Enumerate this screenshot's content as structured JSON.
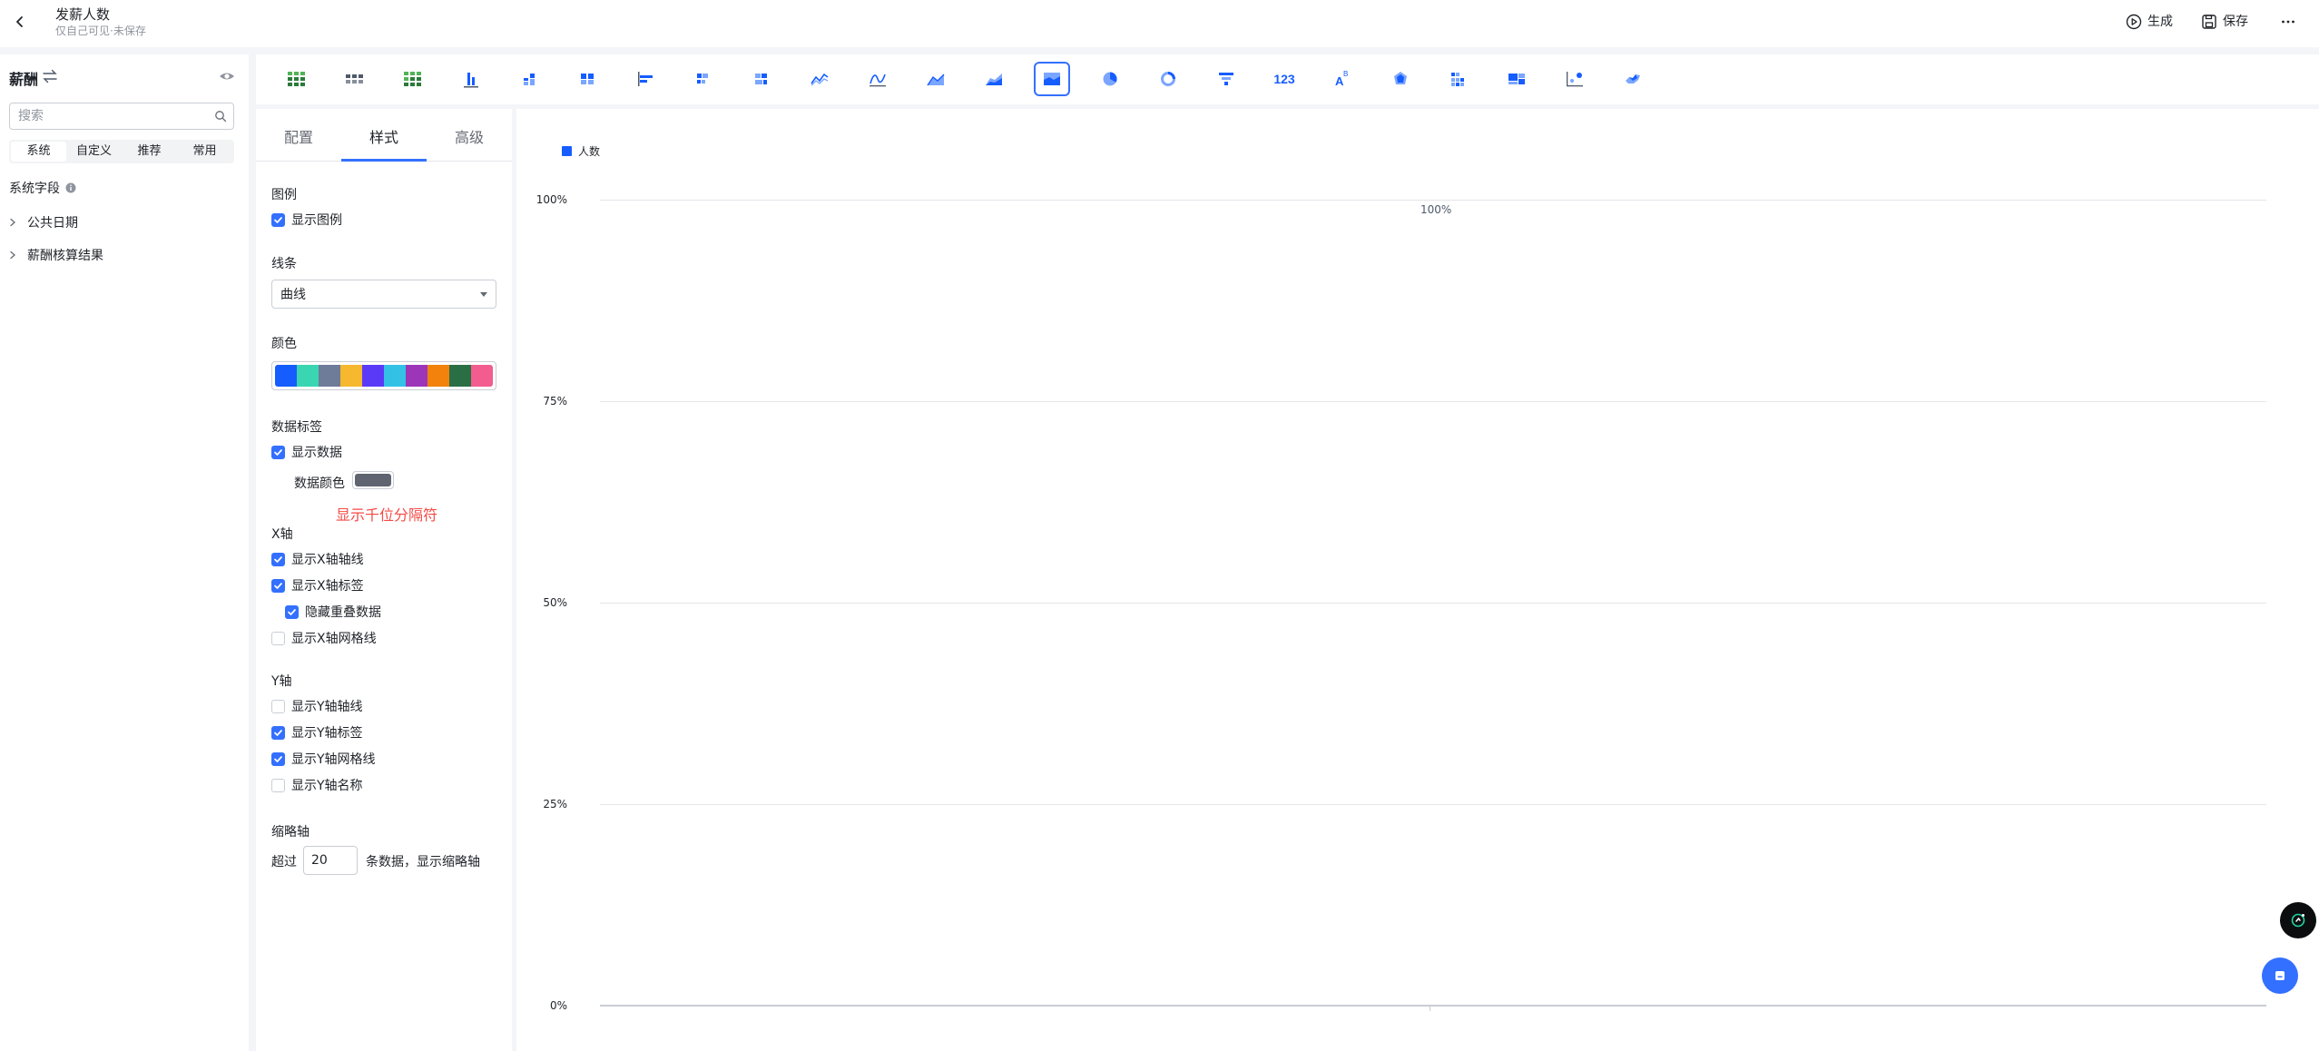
{
  "header": {
    "title": "发薪人数",
    "subtitle": "仅自己可见·未保存",
    "generate_label": "生成",
    "save_label": "保存"
  },
  "left_panel": {
    "dataset_name": "薪酬",
    "search_placeholder": "搜索",
    "segments": [
      "系统",
      "自定义",
      "推荐",
      "常用"
    ],
    "active_segment": "系统",
    "system_fields_label": "系统字段",
    "tree": [
      "公共日期",
      "薪酬核算结果"
    ]
  },
  "chart_types": [
    "table-icon",
    "pivot-table-icon",
    "cross-table-icon",
    "column-chart-icon",
    "stacked-column-icon",
    "grouped-column-icon",
    "bar-chart-icon",
    "stacked-bar-icon",
    "percent-bar-icon",
    "line-chart-icon",
    "smooth-line-icon",
    "area-chart-icon",
    "stacked-area-icon",
    "percent-area-icon",
    "pie-chart-icon",
    "donut-chart-icon",
    "funnel-chart-icon",
    "number-card-icon",
    "word-cloud-icon",
    "radar-chart-icon",
    "heatmap-icon",
    "treemap-icon",
    "scatter-chart-icon",
    "map-chart-icon"
  ],
  "active_chart_type": "percent-area-icon",
  "style_panel": {
    "tabs": [
      "配置",
      "样式",
      "高级"
    ],
    "active_tab": "样式",
    "legend_section": "图例",
    "show_legend": "显示图例",
    "line_section": "线条",
    "line_type": "曲线",
    "color_section": "颜色",
    "palette": [
      "#165dff",
      "#3ad6b2",
      "#6e7b99",
      "#f5b82e",
      "#5b3af7",
      "#33c2e6",
      "#9c35b8",
      "#f2820c",
      "#2a6e44",
      "#f25c8f"
    ],
    "data_label_section": "数据标签",
    "show_data": "显示数据",
    "data_color_label": "数据颜色",
    "data_color": "#5f6470",
    "thousands_sep": "显示千位分隔符",
    "x_section": "X轴",
    "x_options": [
      {
        "label": "显示X轴轴线",
        "checked": true
      },
      {
        "label": "显示X轴标签",
        "checked": true
      },
      {
        "label": "隐藏重叠数据",
        "checked": true
      },
      {
        "label": "显示X轴网格线",
        "checked": false
      }
    ],
    "y_section": "Y轴",
    "y_options": [
      {
        "label": "显示Y轴轴线",
        "checked": false
      },
      {
        "label": "显示Y轴标签",
        "checked": true
      },
      {
        "label": "显示Y轴网格线",
        "checked": true
      },
      {
        "label": "显示Y轴名称",
        "checked": false
      }
    ],
    "thumb_section": "缩略轴",
    "thumb_prefix": "超过",
    "thumb_value": "20",
    "thumb_suffix": "条数据，显示缩略轴"
  },
  "chart_data": {
    "type": "area",
    "legend": [
      "人数"
    ],
    "legend_position": "top-left",
    "y_ticks": [
      "100%",
      "75%",
      "50%",
      "25%",
      "0%"
    ],
    "ylim": [
      0,
      100
    ],
    "grid": true,
    "series": [
      {
        "name": "人数",
        "values": [
          100
        ]
      }
    ],
    "data_labels": [
      "100%"
    ],
    "color": "#165dff"
  }
}
